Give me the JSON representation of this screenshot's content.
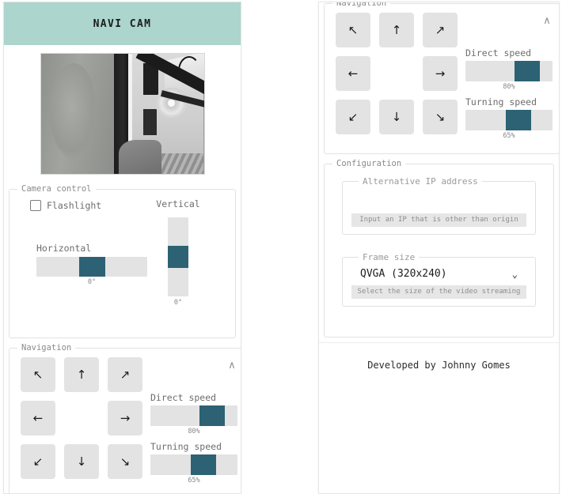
{
  "app": {
    "title": "NAVI CAM",
    "footer": "Developed by Johnny Gomes",
    "accent": "#2c6274",
    "header_bg": "#abd5cd",
    "track_bg": "#e3e3e3"
  },
  "video": {
    "alt": "live grayscale navigation camera feed"
  },
  "camera_control": {
    "legend": "Camera control",
    "flashlight_label": "Flashlight",
    "flashlight_checked": false,
    "horizontal": {
      "label": "Horizontal",
      "value": "0°",
      "percent": 50
    },
    "vertical": {
      "label": "Vertical",
      "value": "0°",
      "percent": 50
    }
  },
  "navigation": {
    "legend": "Navigation",
    "collapse_icon": "∧",
    "buttons": [
      {
        "name": "up-left",
        "glyph": "↖"
      },
      {
        "name": "up",
        "glyph": "↑"
      },
      {
        "name": "up-right",
        "glyph": "↗"
      },
      {
        "name": "left",
        "glyph": "←"
      },
      {
        "name": "center",
        "glyph": ""
      },
      {
        "name": "right",
        "glyph": "→"
      },
      {
        "name": "down-left",
        "glyph": "↙"
      },
      {
        "name": "down",
        "glyph": "↓"
      },
      {
        "name": "down-right",
        "glyph": "↘"
      }
    ],
    "direct_speed": {
      "label": "Direct speed",
      "value": "80%",
      "percent": 80
    },
    "turning_speed": {
      "label": "Turning speed",
      "value": "65%",
      "percent": 65
    }
  },
  "configuration": {
    "legend": "Configuration",
    "ip": {
      "label": "Alternative IP address",
      "value": "",
      "placeholder": "",
      "helper": "Input an IP that is other than origin"
    },
    "frame_size": {
      "label": "Frame size",
      "selected": "QVGA (320x240)",
      "helper": "Select the size of the video streaming",
      "caret_icon": "⌄"
    }
  }
}
